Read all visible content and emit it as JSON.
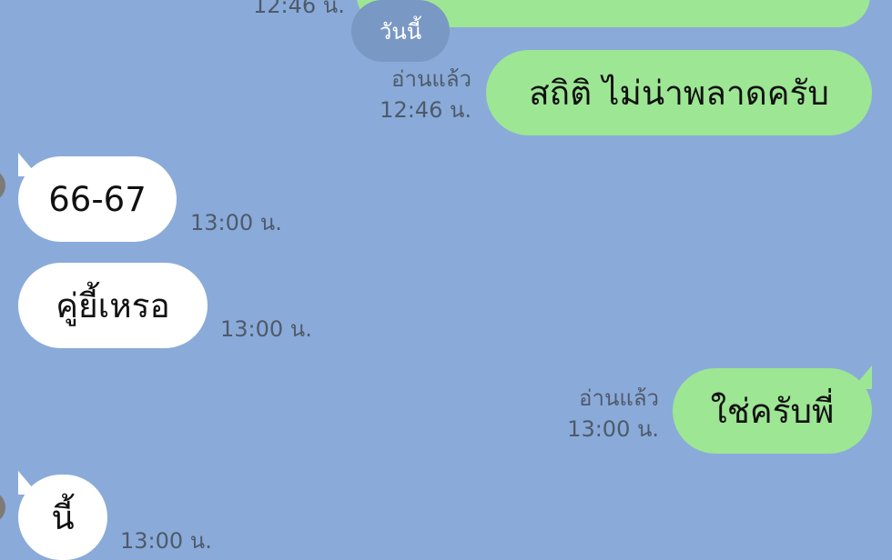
{
  "top_partial": {
    "time": "12:46 น."
  },
  "date_separator": {
    "label": "วันนี้"
  },
  "messages": [
    {
      "side": "outgoing",
      "text": "สถิติ ไม่น่าพลาดครับ",
      "read": "อ่านแล้ว",
      "time": "12:46 น."
    },
    {
      "side": "incoming",
      "text": "66-67",
      "time": "13:00 น."
    },
    {
      "side": "incoming",
      "text": "คู่ยี้เหรอ",
      "time": "13:00 น."
    },
    {
      "side": "outgoing",
      "text": "ใช่ครับพี่",
      "read": "อ่านแล้ว",
      "time": "13:00 น."
    },
    {
      "side": "incoming",
      "text": "นี้",
      "time": "13:00 น."
    }
  ],
  "colors": {
    "background": "#8aabd9",
    "outgoing_bubble": "#9de694",
    "incoming_bubble": "#ffffff",
    "meta_text": "#4e5a6a"
  }
}
